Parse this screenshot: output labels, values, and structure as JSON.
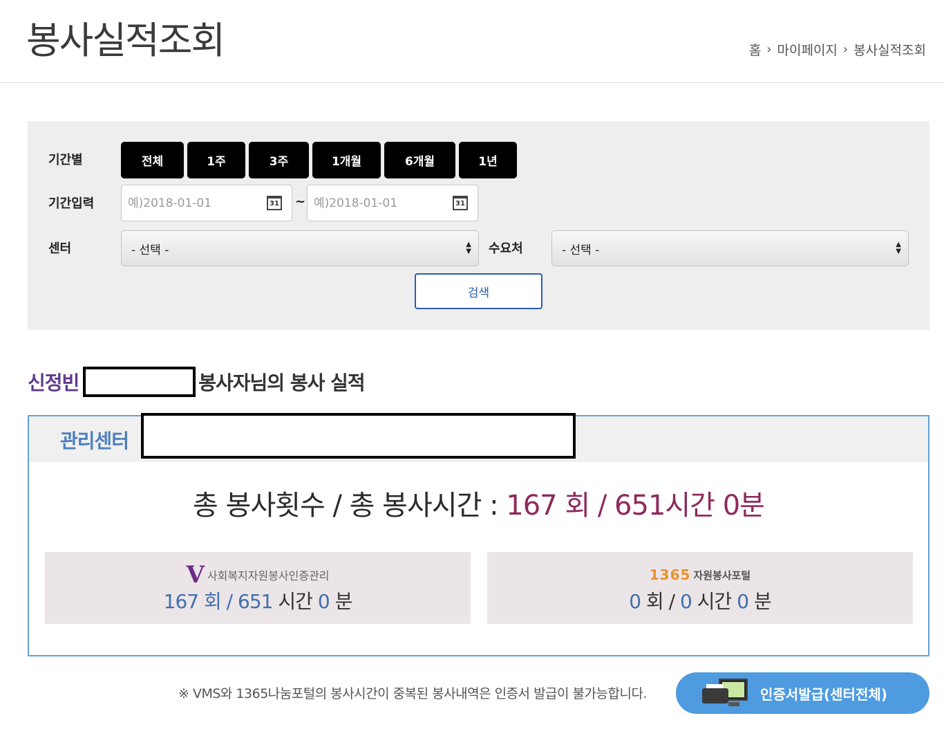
{
  "page": {
    "title": "봉사실적조회",
    "breadcrumb": [
      "홈",
      "마이페이지",
      "봉사실적조회"
    ]
  },
  "search": {
    "period_label": "기간별",
    "period_buttons": [
      "전체",
      "1주",
      "3주",
      "1개월",
      "6개월",
      "1년"
    ],
    "date_label": "기간입력",
    "date_from_placeholder": "예)2018-01-01",
    "date_to_placeholder": "예)2018-01-01",
    "date_separator": "~",
    "calendar_icon_text": "31",
    "center_label": "센터",
    "center_value": "- 선택 -",
    "demand_label": "수요처",
    "demand_value": "- 선택 -",
    "search_button": "검색"
  },
  "result": {
    "volunteer_name": "신정빈",
    "volunteer_suffix": "봉사자님의 봉사 실적",
    "center_label": "관리센터",
    "totals_label": "총 봉사횟수 / 총 봉사시간 :",
    "totals_value": "167 회 / 651시간 0분",
    "vms": {
      "logo_mark": "V",
      "logo_text": "사회복지자원봉사인증관리",
      "count": "167",
      "count_unit": "회 /",
      "hours": "651",
      "hours_unit": "시간",
      "minutes": "0",
      "minutes_unit": "분"
    },
    "portal": {
      "logo_num": "1365",
      "logo_text": "자원봉사포털",
      "count": "0",
      "count_unit": "회 /",
      "hours": "0",
      "hours_unit": "시간",
      "minutes": "0",
      "minutes_unit": "분"
    }
  },
  "footer": {
    "notice": "※ VMS와 1365나눔포털의 봉사시간이 중복된 봉사내역은 인증서 발급이 불가능합니다.",
    "cert_button": "인증서발급(센터전체)"
  },
  "colors": {
    "accent_blue": "#2a5db0",
    "name_purple": "#5e3a8c",
    "totals_value": "#8e2a5b",
    "cert_button_bg": "#4e9be0"
  }
}
